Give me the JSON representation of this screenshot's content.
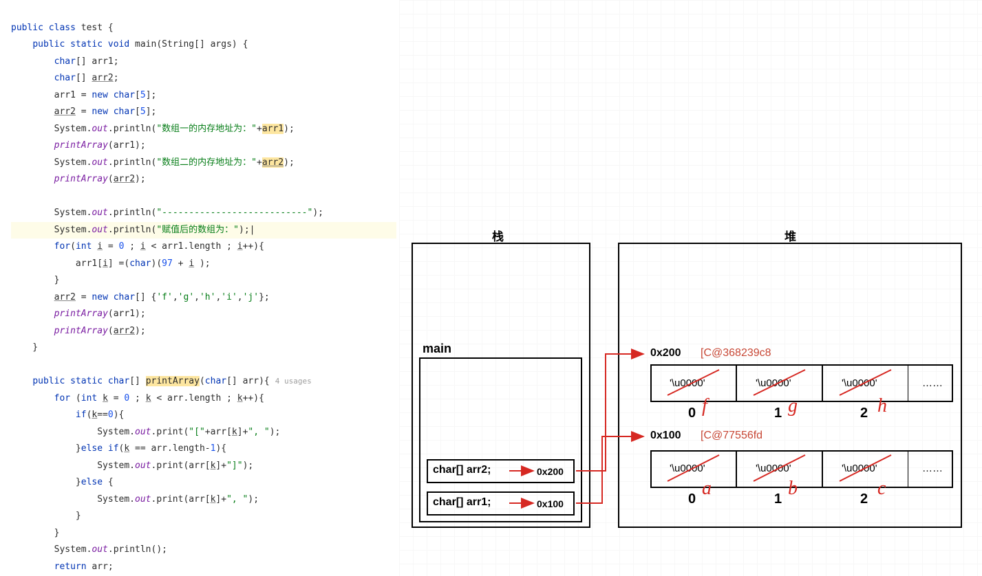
{
  "code": {
    "class_hdr": "public class test {",
    "main_hdr": "public static void main(String[] args) {",
    "l3": "char[] arr1;",
    "l4": "char[] arr2;",
    "l5": "arr1 = new char[5];",
    "l6": "arr2 = new char[5];",
    "l7": "System.out.println(\"数组一的内存地址为：\"+arr1);",
    "l8": "printArray(arr1);",
    "l9": "System.out.println(\"数组二的内存地址为：\"+arr2);",
    "l10": "printArray(arr2);",
    "l11": "System.out.println(\"---------------------------\");",
    "l12": "System.out.println(\"赋值后的数组为：\");",
    "l13": "for(int i = 0 ; i < arr1.length ; i++){",
    "l14": "arr1[i] =(char)(97 + i );",
    "l15": "}",
    "l16": "arr2 = new char[] {'f','g','h','i','j'};",
    "l17": "printArray(arr1);",
    "l18": "printArray(arr2);",
    "l19": "}",
    "print_hdr": "public static char[] printArray(char[] arr){",
    "usages": "4 usages",
    "l21": "for (int k = 0 ; k < arr.length ; k++){",
    "l22": "if(k==0){",
    "l23": "System.out.print(\"[\"+arr[k]+\", \");",
    "l24": "}else if(k == arr.length-1){",
    "l25": "System.out.print(arr[k]+\"]\");",
    "l26": "}else {",
    "l27": "System.out.print(arr[k]+\", \");",
    "l28": "}",
    "l29": "}",
    "l30": "System.out.println();",
    "l31": "return arr;"
  },
  "diagram": {
    "stack_title": "栈",
    "heap_title": "堆",
    "main_label": "main",
    "arr2_decl": "char[] arr2;",
    "arr1_decl": "char[] arr1;",
    "addr2": "0x200",
    "addr1": "0x100",
    "heap_addr2": "0x200",
    "heap_addr1": "0x100",
    "objref2": "[C@368239c8",
    "objref1": "[C@77556fd",
    "cell": "'\\u0000'",
    "dots": "……",
    "idx0": "0",
    "idx1": "1",
    "idx2": "2",
    "hand_f": "f",
    "hand_g": "g",
    "hand_h": "h",
    "hand_a": "a",
    "hand_b": "b",
    "hand_c": "c"
  }
}
